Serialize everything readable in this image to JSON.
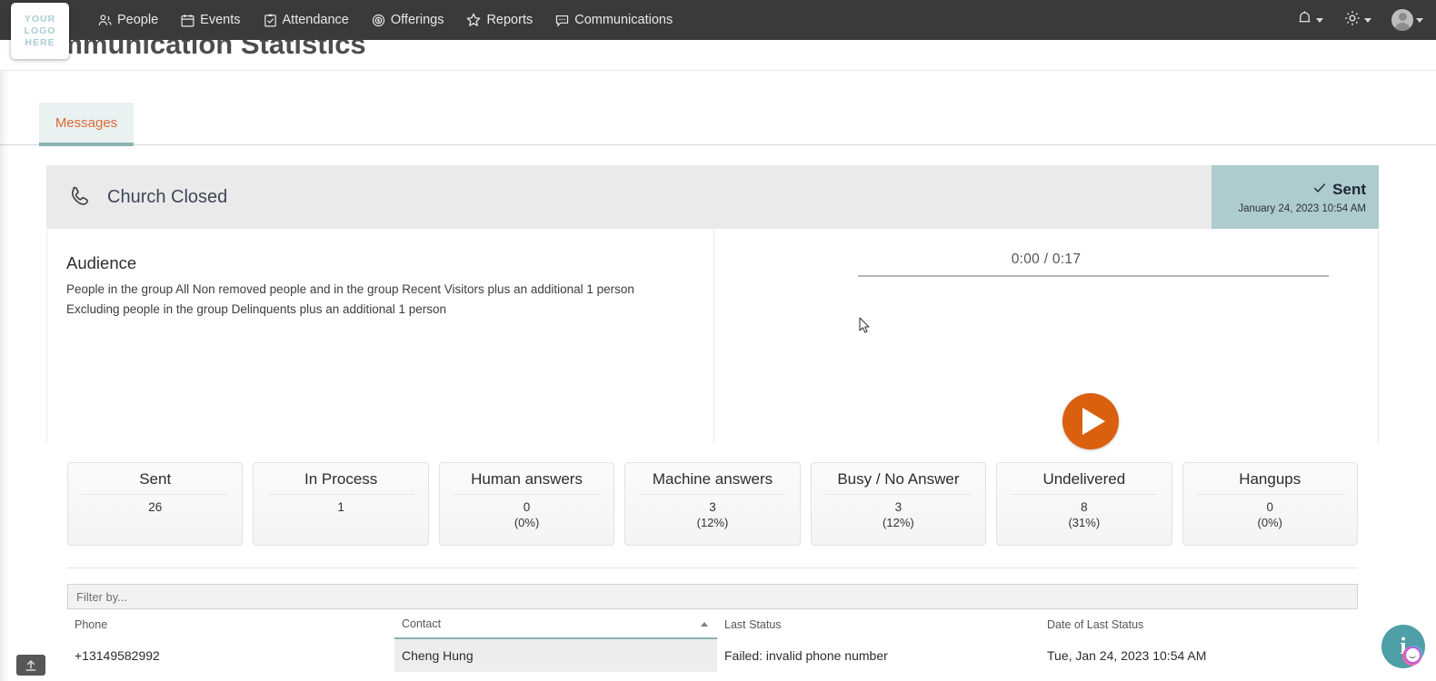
{
  "app": {
    "logo_lines": [
      "YOUR",
      "LOGO",
      "HERE"
    ],
    "page_title": "Communication Statistics"
  },
  "nav": {
    "items": [
      {
        "label": "People",
        "icon": "people-icon"
      },
      {
        "label": "Events",
        "icon": "calendar-icon"
      },
      {
        "label": "Attendance",
        "icon": "clipboard-check-icon"
      },
      {
        "label": "Offerings",
        "icon": "coin-dollar-icon"
      },
      {
        "label": "Reports",
        "icon": "star-icon"
      },
      {
        "label": "Communications",
        "icon": "chat-bubble-icon"
      }
    ],
    "right": [
      {
        "name": "notifications",
        "icon": "bell-icon"
      },
      {
        "name": "settings",
        "icon": "gear-icon"
      },
      {
        "name": "account",
        "icon": "avatar-icon"
      }
    ]
  },
  "tabs": [
    {
      "label": "Messages",
      "active": true
    }
  ],
  "message": {
    "icon": "phone-icon",
    "title": "Church Closed",
    "status": {
      "icon": "check-icon",
      "label": "Sent",
      "date": "January 24, 2023 10:54 AM"
    }
  },
  "audience": {
    "heading": "Audience",
    "lines": [
      "People in the group All Non removed people and in the group Recent Visitors plus an additional 1 person",
      "Excluding people in the group Delinquents plus an additional 1 person"
    ]
  },
  "player": {
    "current_time": "0:00",
    "total_time": "0:17",
    "time_display": "0:00 / 0:17",
    "progress_percent": 0,
    "play_button_label": "play-button",
    "accent_color": "#d9600f"
  },
  "stats": [
    {
      "title": "Sent",
      "value": "26",
      "percent": ""
    },
    {
      "title": "In Process",
      "value": "1",
      "percent": ""
    },
    {
      "title": "Human answers",
      "value": "0",
      "percent": "(0%)"
    },
    {
      "title": "Machine answers",
      "value": "3",
      "percent": "(12%)"
    },
    {
      "title": "Busy / No Answer",
      "value": "3",
      "percent": "(12%)"
    },
    {
      "title": "Undelivered",
      "value": "8",
      "percent": "(31%)"
    },
    {
      "title": "Hangups",
      "value": "0",
      "percent": "(0%)"
    }
  ],
  "filter": {
    "value": "",
    "placeholder": "Filter by..."
  },
  "table": {
    "columns": [
      {
        "label": "Phone",
        "sorted": false
      },
      {
        "label": "Contact",
        "sorted": true,
        "direction": "asc"
      },
      {
        "label": "Last Status",
        "sorted": false
      },
      {
        "label": "Date of Last Status",
        "sorted": false
      }
    ],
    "rows": [
      {
        "phone": "+13149582992",
        "contact": "Cheng Hung",
        "last_status": "Failed: invalid phone number",
        "date_of_last_status": "Tue, Jan 24, 2023 10:54 AM"
      }
    ]
  },
  "corner": {
    "help_button": "help-assistant-button",
    "upload_button": "upload-button"
  },
  "colors": {
    "nav_bg": "#3a3a3a",
    "tab_text": "#d96a35",
    "tab_bg": "#eaf1f1",
    "tab_underline": "#8cb3b3",
    "status_chip_bg": "#aecbce",
    "card_header_bg": "#eaeaea",
    "play_button": "#d9600f",
    "help_fab": "#4e9fa7"
  }
}
